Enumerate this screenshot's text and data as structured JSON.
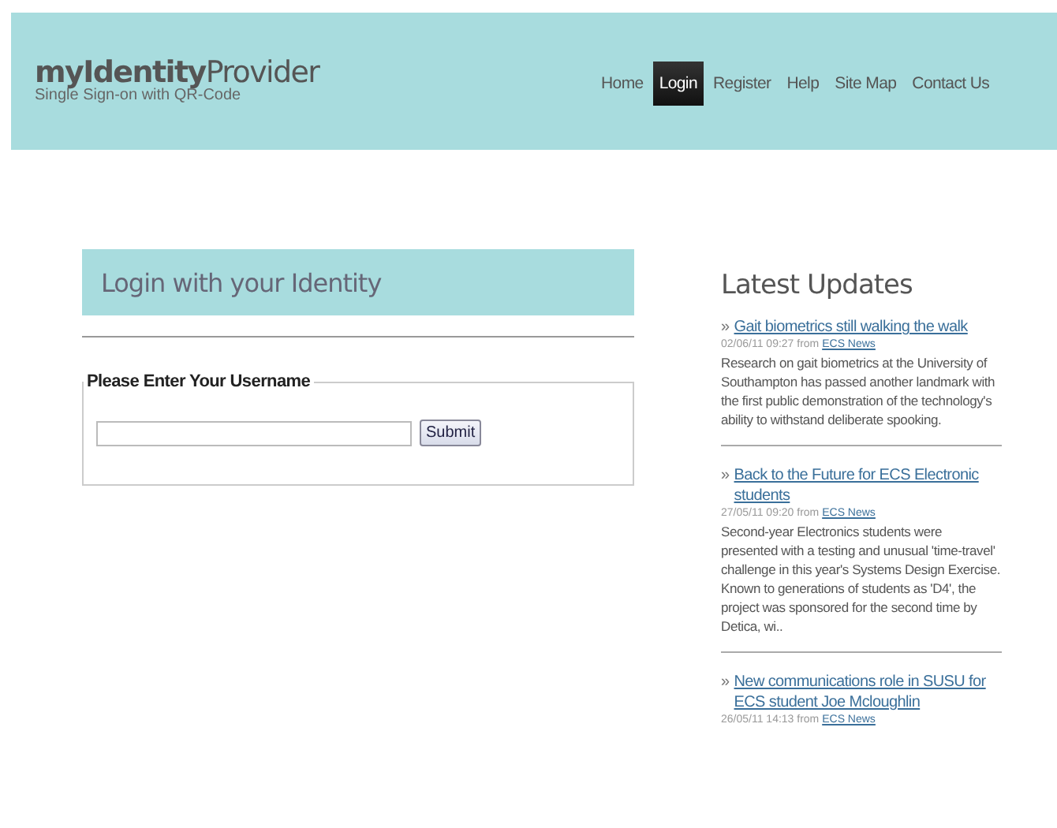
{
  "header": {
    "logo": "**myIdentity**Provider",
    "tagline": "Single Sign-on with QR-Code",
    "nav": [
      {
        "label": "Home",
        "selected": false
      },
      {
        "label": "Login",
        "selected": true
      },
      {
        "label": "Register",
        "selected": false
      },
      {
        "label": "Help",
        "selected": false
      },
      {
        "label": "Site Map",
        "selected": false
      },
      {
        "label": "Contact Us",
        "selected": false
      }
    ]
  },
  "login": {
    "title": "Login with your Identity",
    "legend": "Please Enter Your Username",
    "button": "Submit"
  },
  "updates": {
    "title": "Latest Updates",
    "items": [
      {
        "marker": "»",
        "headline": "Gait biometrics still walking the walk",
        "date": "02/06/11 09:27 from",
        "source": "ECS News",
        "summary": "Research on gait biometrics at the University of Southampton has passed another landmark with the first public demonstration of the technology's ability to withstand deliberate spooking."
      },
      {
        "marker": "»",
        "headline": "Back to the Future for ECS Electronic students",
        "date": "27/05/11 09:20 from",
        "source": "ECS News",
        "summary": "Second-year Electronics students were presented with a testing and unusual 'time-travel' challenge in this year's Systems Design Exercise. Known to generations of students as 'D4', the project was sponsored for the second time by Detica, wi.."
      },
      {
        "marker": "»",
        "headline": "New communications role in SUSU for ECS student Joe Mcloughlin",
        "date": "26/05/11 14:13 from",
        "source": "ECS News"
      }
    ]
  }
}
